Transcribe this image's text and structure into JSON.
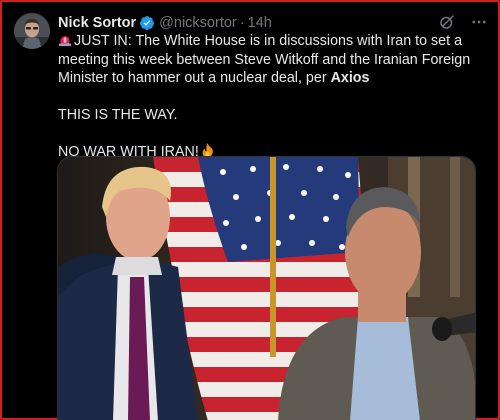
{
  "tweet": {
    "author_name": "Nick Sortor",
    "handle": "@nicksortor",
    "separator": "·",
    "timestamp": "14h",
    "line1": "JUST IN: The White House is in discussions with Iran to set a meeting this week between Steve Witkoff and the Iranian Foreign Minister to hammer out a nuclear deal, per ",
    "source": "Axios",
    "line2": "THIS IS THE WAY.",
    "line3": "NO WAR WITH IRAN!"
  },
  "icons": {
    "verified": "verified-badge-icon",
    "grok": "grok-icon",
    "more": "more-options-icon",
    "siren": "siren-emoji-icon",
    "fire": "fire-emoji-icon"
  },
  "colors": {
    "background": "#000000",
    "text": "#e7e9ea",
    "muted": "#71767b",
    "verified": "#1d9bf0",
    "frame": "#d21f1f"
  }
}
